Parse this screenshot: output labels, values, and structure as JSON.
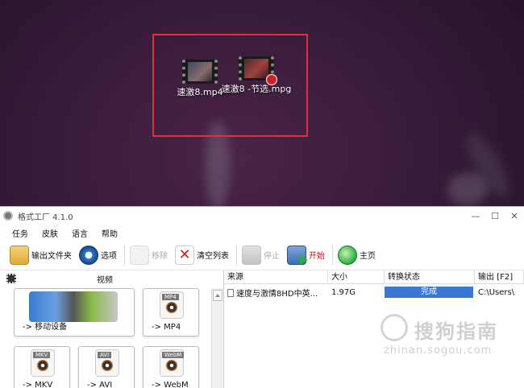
{
  "desktop": {
    "icons": [
      {
        "label": "速激8.mp4"
      },
      {
        "label": "速激8 -节选.mpg"
      }
    ]
  },
  "window": {
    "title": "格式工厂 4.1.0",
    "controls": {
      "minimize": "—",
      "maximize": "☐",
      "close": "✕"
    }
  },
  "menu": [
    "任务",
    "皮肤",
    "语言",
    "帮助"
  ],
  "toolbar": {
    "output_folder": "输出文件夹",
    "options": "选项",
    "remove": "移除",
    "clear_list": "清空列表",
    "stop": "停止",
    "start": "开始",
    "home": "主页"
  },
  "left_panel": {
    "header": "视频",
    "tiles": [
      {
        "label": "-> 移动设备"
      },
      {
        "label": "-> MP4",
        "tag": "MP4"
      },
      {
        "label": "-> MKV",
        "tag": "MKV"
      },
      {
        "label": "-> AVI",
        "tag": "AVI"
      },
      {
        "label": "-> WebM",
        "tag": "WebM"
      }
    ]
  },
  "task_list": {
    "columns": [
      "来源",
      "大小",
      "转换状态",
      "输出 [F2]"
    ],
    "rows": [
      {
        "source": "速度与激情8HD中英...",
        "size": "1.97G",
        "status": "完成",
        "output": "C:\\Users\\"
      }
    ]
  },
  "watermark": {
    "text": "搜狗指南",
    "url": "zhinan.sogou.com"
  },
  "colors": {
    "highlight_border": "#e0303a",
    "status_complete": "#3a78d8",
    "start_label": "#c01010"
  }
}
